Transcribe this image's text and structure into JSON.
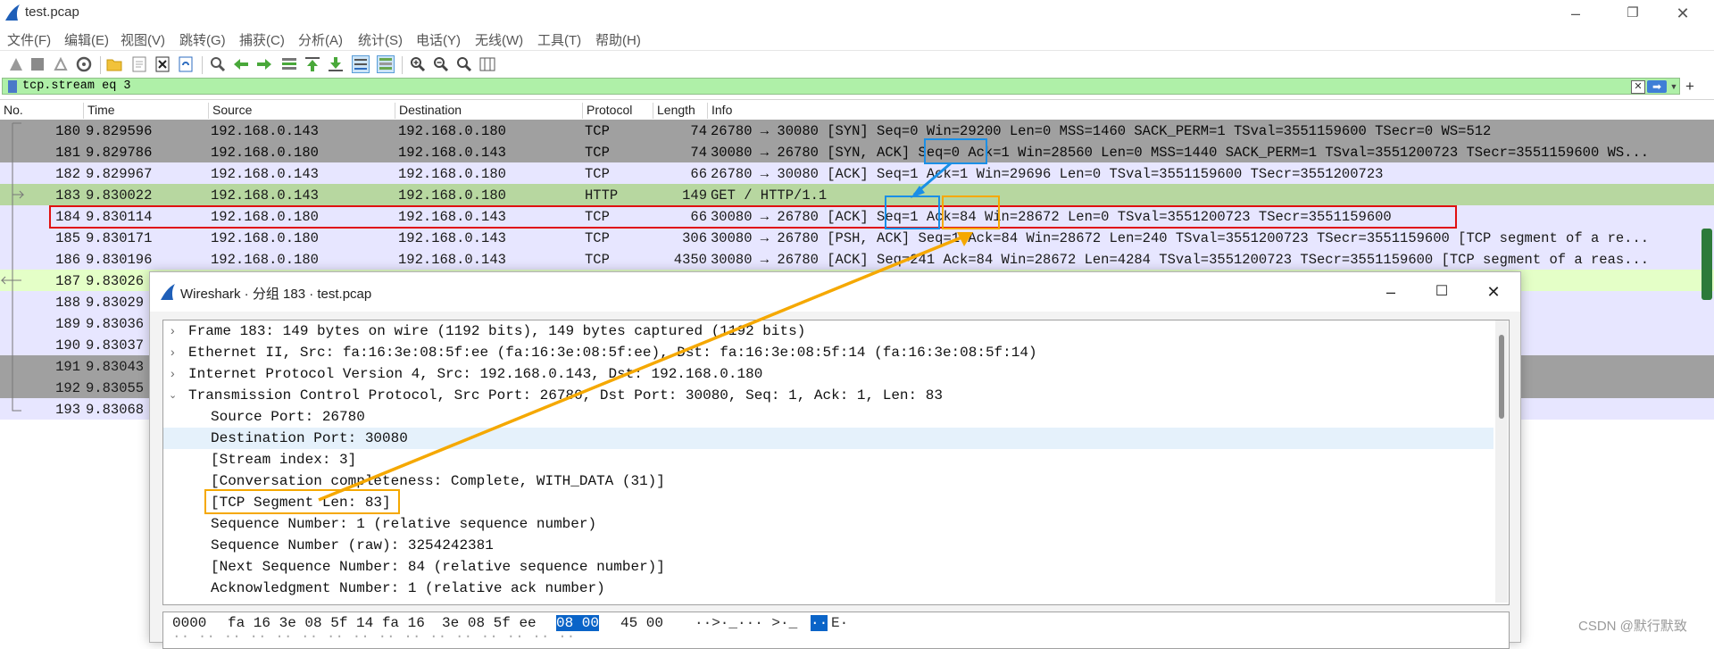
{
  "window": {
    "title": "test.pcap"
  },
  "menu": [
    "文件(F)",
    "编辑(E)",
    "视图(V)",
    "跳转(G)",
    "捕获(C)",
    "分析(A)",
    "统计(S)",
    "电话(Y)",
    "无线(W)",
    "工具(T)",
    "帮助(H)"
  ],
  "filter": {
    "value": "tcp.stream eq 3"
  },
  "columns": [
    "No.",
    "Time",
    "Source",
    "Destination",
    "Protocol",
    "Length",
    "Info"
  ],
  "packets": [
    {
      "no": "180",
      "time": "9.829596",
      "src": "192.168.0.143",
      "dst": "192.168.0.180",
      "proto": "TCP",
      "len": "74",
      "info": "26780 → 30080 [SYN] Seq=0 Win=29200 Len=0 MSS=1460 SACK_PERM=1 TSval=3551159600 TSecr=0 WS=512"
    },
    {
      "no": "181",
      "time": "9.829786",
      "src": "192.168.0.180",
      "dst": "192.168.0.143",
      "proto": "TCP",
      "len": "74",
      "info": "30080 → 26780 [SYN, ACK] Seq=0 Ack=1 Win=28560 Len=0 MSS=1440 SACK_PERM=1 TSval=3551200723 TSecr=3551159600 WS..."
    },
    {
      "no": "182",
      "time": "9.829967",
      "src": "192.168.0.143",
      "dst": "192.168.0.180",
      "proto": "TCP",
      "len": "66",
      "info": "26780 → 30080 [ACK] Seq=1 Ack=1 Win=29696 Len=0 TSval=3551159600 TSecr=3551200723"
    },
    {
      "no": "183",
      "time": "9.830022",
      "src": "192.168.0.143",
      "dst": "192.168.0.180",
      "proto": "HTTP",
      "len": "149",
      "info": "GET / HTTP/1.1"
    },
    {
      "no": "184",
      "time": "9.830114",
      "src": "192.168.0.180",
      "dst": "192.168.0.143",
      "proto": "TCP",
      "len": "66",
      "info": "30080 → 26780 [ACK] Seq=1 Ack=84 Win=28672 Len=0 TSval=3551200723 TSecr=3551159600"
    },
    {
      "no": "185",
      "time": "9.830171",
      "src": "192.168.0.180",
      "dst": "192.168.0.143",
      "proto": "TCP",
      "len": "306",
      "info": "30080 → 26780 [PSH, ACK] Seq=1 Ack=84 Win=28672 Len=240 TSval=3551200723 TSecr=3551159600 [TCP segment of a re..."
    },
    {
      "no": "186",
      "time": "9.830196",
      "src": "192.168.0.180",
      "dst": "192.168.0.143",
      "proto": "TCP",
      "len": "4350",
      "info": "30080 → 26780 [ACK] Seq=241 Ack=84 Win=28672 Len=4284 TSval=3551200723 TSecr=3551159600 [TCP segment of a reas..."
    },
    {
      "no": "187",
      "time": "9.83026"
    },
    {
      "no": "188",
      "time": "9.83029"
    },
    {
      "no": "189",
      "time": "9.83036"
    },
    {
      "no": "190",
      "time": "9.83037"
    },
    {
      "no": "191",
      "time": "9.83043"
    },
    {
      "no": "192",
      "time": "9.83055"
    },
    {
      "no": "193",
      "time": "9.83068"
    }
  ],
  "dialog": {
    "title": "Wireshark · 分组 183 · test.pcap",
    "tree": [
      "Frame 183: 149 bytes on wire (1192 bits), 149 bytes captured (1192 bits)",
      "Ethernet II, Src: fa:16:3e:08:5f:ee (fa:16:3e:08:5f:ee), Dst: fa:16:3e:08:5f:14 (fa:16:3e:08:5f:14)",
      "Internet Protocol Version 4, Src: 192.168.0.143, Dst: 192.168.0.180",
      "Transmission Control Protocol, Src Port: 26780, Dst Port: 30080, Seq: 1, Ack: 1, Len: 83",
      "Source Port: 26780",
      "Destination Port: 30080",
      "[Stream index: 3]",
      "[Conversation completeness: Complete, WITH_DATA (31)]",
      "[TCP Segment Len: 83]",
      "Sequence Number: 1    (relative sequence number)",
      "Sequence Number (raw): 3254242381",
      "[Next Sequence Number: 84    (relative sequence number)]",
      "Acknowledgment Number: 1    (relative ack number)"
    ],
    "hex": {
      "offset": "0000",
      "bytes_a": "fa 16 3e 08 5f 14 fa 16  3e 08 5f ee",
      "bytes_hl": "08 00",
      "bytes_b": "45 00",
      "ascii_a": "··>·_··· >·_",
      "ascii_hl": "··",
      "ascii_b": "E·"
    }
  },
  "watermark": "CSDN @默行默致"
}
